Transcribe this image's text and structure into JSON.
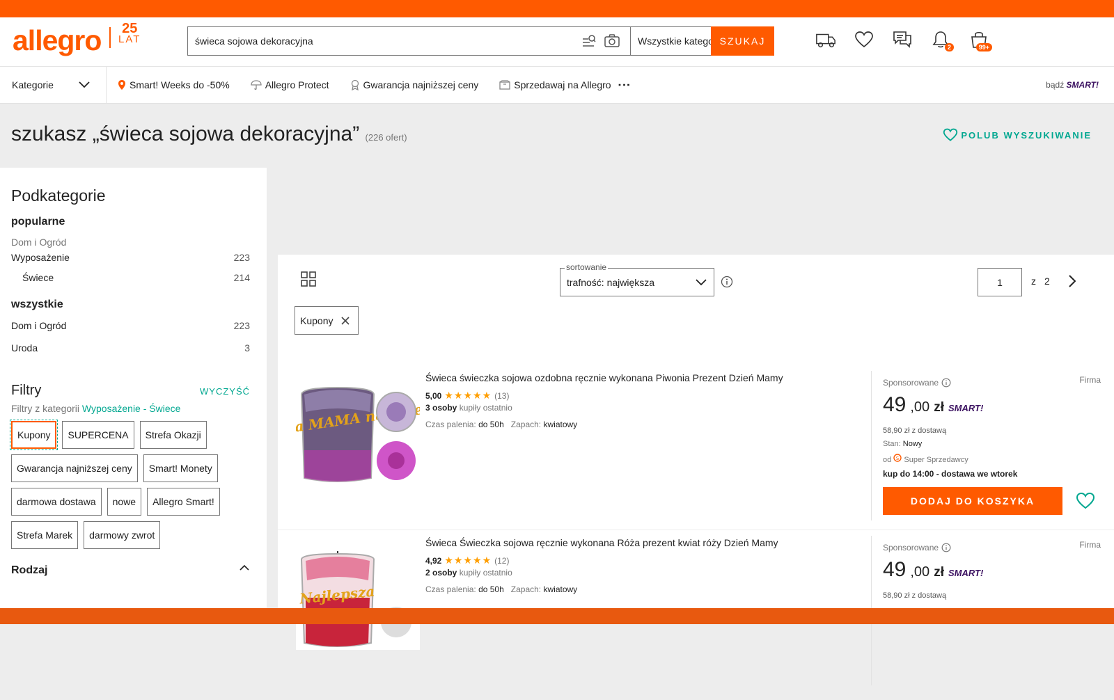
{
  "header": {
    "logo": "allegro",
    "anniversary_num": "25",
    "anniversary_word": "LAT",
    "search_value": "świeca sojowa dekoracyjna",
    "category_select": "Wszystkie kategorie",
    "search_button": "SZUKAJ",
    "notif_badge": "2",
    "cart_badge": "99+"
  },
  "nav": {
    "categories": "Kategorie",
    "items": [
      "Smart! Weeks do -50%",
      "Allegro Protect",
      "Gwarancja najniższej ceny",
      "Sprzedawaj na Allegro"
    ],
    "promo_prefix": "bądź",
    "promo_brand": "SMART!"
  },
  "page": {
    "title": "szukasz „świeca sojowa dekoracyjna”",
    "count": "(226 ofert)",
    "like_search": "POLUB WYSZUKIWANIE"
  },
  "sidebar": {
    "heading": "Podkategorie",
    "popular_heading": "popularne",
    "popular_parent": "Dom i Ogród",
    "popular_rows": [
      {
        "label": "Wyposażenie",
        "count": "223"
      },
      {
        "label": "Świece",
        "count": "214"
      }
    ],
    "all_heading": "wszystkie",
    "all_rows": [
      {
        "label": "Dom i Ogród",
        "count": "223"
      },
      {
        "label": "Uroda",
        "count": "3"
      }
    ],
    "filters_heading": "Filtry",
    "clear": "WYCZYŚĆ",
    "filters_from_prefix": "Filtry z kategorii",
    "filters_from_link": "Wyposażenie - Świece",
    "chips": [
      "Kupony",
      "SUPERCENA",
      "Strefa Okazji",
      "Gwarancja najniższej ceny",
      "Smart! Monety",
      "darmowa dostawa",
      "nowe",
      "Allegro Smart!",
      "Strefa Marek",
      "darmowy zwrot"
    ],
    "rodzaj": "Rodzaj"
  },
  "listing": {
    "sort_legend": "sortowanie",
    "sort_value": "trafność: największa",
    "page_current": "1",
    "page_of": "z",
    "page_total": "2",
    "active_filter": "Kupony",
    "offers": [
      {
        "title": "Świeca świeczka sojowa ozdobna ręcznie wykonana Piwonia Prezent Dzień Mamy",
        "rating": "5,00",
        "stars": "★★★★★",
        "reviews": "(13)",
        "bought_bold": "3 osoby",
        "bought_rest": "kupiły ostatnio",
        "param1_label": "Czas palenia:",
        "param1_value": "do 50h",
        "param2_label": "Zapach:",
        "param2_value": "kwiatowy",
        "img_text": "Najlepsza MAMA na świecie",
        "sponsored": "Sponsorowane",
        "seller_type": "Firma",
        "price_int": "49",
        "price_dec": ",00",
        "price_cur": "zł",
        "smart": "SMART!",
        "delivery": "58,90 zł z dostawą",
        "stan_label": "Stan:",
        "stan_value": "Nowy",
        "seller_prefix": "od",
        "seller_label": "Super Sprzedawcy",
        "kup_bold": "kup do 14:00",
        "kup_rest": "- dostawa we wtorek",
        "cart": "DODAJ DO KOSZYKA"
      },
      {
        "title": "Świeca Świeczka sojowa ręcznie wykonana Róża prezent kwiat róży Dzień Mamy",
        "rating": "4,92",
        "stars": "★★★★★",
        "reviews": "(12)",
        "bought_bold": "2 osoby",
        "bought_rest": "kupiły ostatnio",
        "param1_label": "Czas palenia:",
        "param1_value": "do 50h",
        "param2_label": "Zapach:",
        "param2_value": "kwiatowy",
        "img_text": "Najlepsza",
        "sponsored": "Sponsorowane",
        "seller_type": "Firma",
        "price_int": "49",
        "price_dec": ",00",
        "price_cur": "zł",
        "smart": "SMART!",
        "delivery": "58,90 zł z dostawą"
      }
    ]
  },
  "colors": {
    "brand": "#ff5a00",
    "accent": "#00a790",
    "smart": "#3c1261"
  }
}
